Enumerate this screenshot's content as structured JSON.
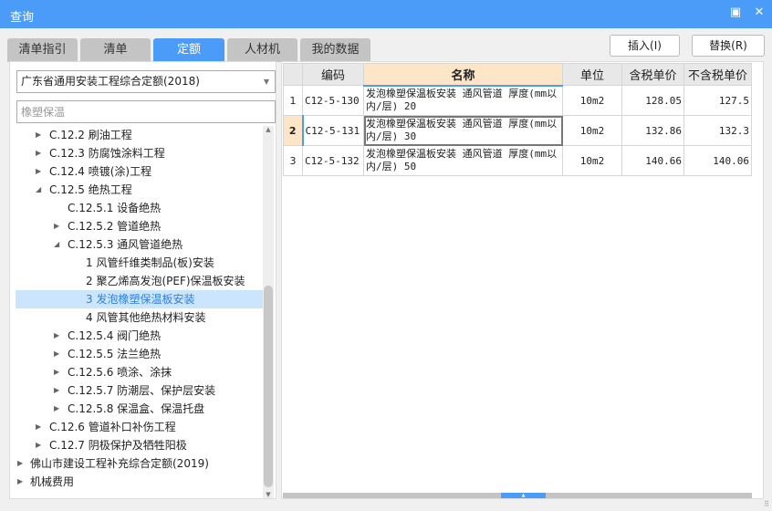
{
  "window": {
    "title": "查询",
    "restore_icon": "restore-icon",
    "close_icon": "close-icon"
  },
  "tabs": [
    {
      "label": "清单指引"
    },
    {
      "label": "清单"
    },
    {
      "label": "定额",
      "active": true
    },
    {
      "label": "人材机"
    },
    {
      "label": "我的数据"
    }
  ],
  "buttons": {
    "insert": "插入(I)",
    "replace": "替换(R)"
  },
  "left": {
    "library": "广东省通用安装工程综合定额(2018)",
    "search_placeholder": "橡塑保温",
    "tree": [
      {
        "label": "C.12.2 刷油工程",
        "level": 2,
        "arrow": "collapsed"
      },
      {
        "label": "C.12.3 防腐蚀涂料工程",
        "level": 2,
        "arrow": "collapsed"
      },
      {
        "label": "C.12.4 喷镀(涂)工程",
        "level": 2,
        "arrow": "collapsed"
      },
      {
        "label": "C.12.5 绝热工程",
        "level": 2,
        "arrow": "expanded"
      },
      {
        "label": "C.12.5.1 设备绝热",
        "level": 3,
        "arrow": "none"
      },
      {
        "label": "C.12.5.2 管道绝热",
        "level": 3,
        "arrow": "collapsed"
      },
      {
        "label": "C.12.5.3 通风管道绝热",
        "level": 3,
        "arrow": "expanded"
      },
      {
        "label": "1 风管纤维类制品(板)安装",
        "level": 4,
        "arrow": "none"
      },
      {
        "label": "2 聚乙烯高发泡(PEF)保温板安装",
        "level": 4,
        "arrow": "none"
      },
      {
        "label": "3 发泡橡塑保温板安装",
        "level": 4,
        "arrow": "none",
        "selected": true
      },
      {
        "label": "4 风管其他绝热材料安装",
        "level": 4,
        "arrow": "none"
      },
      {
        "label": "C.12.5.4 阀门绝热",
        "level": 3,
        "arrow": "collapsed"
      },
      {
        "label": "C.12.5.5 法兰绝热",
        "level": 3,
        "arrow": "collapsed"
      },
      {
        "label": "C.12.5.6 喷涂、涂抹",
        "level": 3,
        "arrow": "collapsed"
      },
      {
        "label": "C.12.5.7 防潮层、保护层安装",
        "level": 3,
        "arrow": "collapsed"
      },
      {
        "label": "C.12.5.8 保温盒、保温托盘",
        "level": 3,
        "arrow": "collapsed"
      },
      {
        "label": "C.12.6 管道补口补伤工程",
        "level": 2,
        "arrow": "collapsed"
      },
      {
        "label": "C.12.7 阴极保护及牺牲阳极",
        "level": 2,
        "arrow": "collapsed"
      },
      {
        "label": "佛山市建设工程补充综合定额(2019)",
        "level": 1,
        "arrow": "collapsed"
      },
      {
        "label": "机械费用",
        "level": 1,
        "arrow": "collapsed"
      }
    ]
  },
  "table": {
    "headers": [
      "",
      "编码",
      "名称",
      "单位",
      "含税单价",
      "不含税单价"
    ],
    "rows": [
      [
        "1",
        "C12-5-130",
        "发泡橡塑保温板安装 通风管道 厚度(mm以内/层) 20",
        "10m2",
        "128.05",
        "127.5"
      ],
      [
        "2",
        "C12-5-131",
        "发泡橡塑保温板安装 通风管道 厚度(mm以内/层) 30",
        "10m2",
        "132.86",
        "132.3"
      ],
      [
        "3",
        "C12-5-132",
        "发泡橡塑保温板安装 通风管道 厚度(mm以内/层) 50",
        "10m2",
        "140.66",
        "140.06"
      ]
    ],
    "current_row": 2
  },
  "colors": {
    "accent": "#4a9cf8",
    "header_highlight": "#fde6c8",
    "selection": "#cce5ff"
  }
}
